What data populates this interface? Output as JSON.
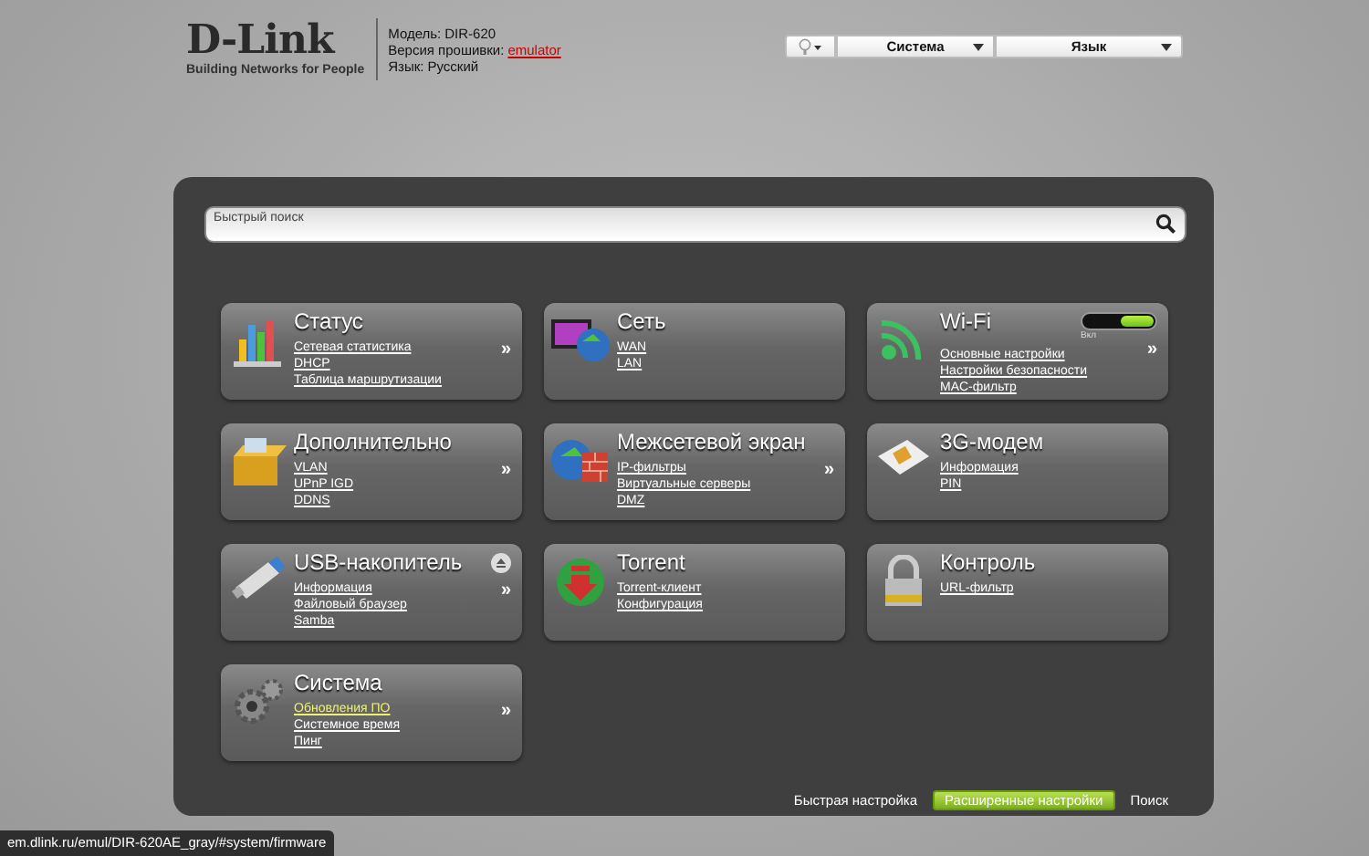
{
  "header": {
    "logo": "D-Link",
    "tagline": "Building Networks for People",
    "info": [
      {
        "label": "Модель:",
        "value": "DIR-620",
        "warn": false
      },
      {
        "label": "Версия прошивки:",
        "value": "emulator",
        "warn": true
      },
      {
        "label": "Язык:",
        "value": "Русский",
        "warn": false
      }
    ],
    "menus": [
      {
        "label": "Система"
      },
      {
        "label": "Язык"
      }
    ]
  },
  "search": {
    "placeholder": "Быстрый поиск"
  },
  "cards": [
    {
      "title": "Статус",
      "more": true,
      "eject": false,
      "links": [
        {
          "text": "Сетевая статистика",
          "highlighted": false
        },
        {
          "text": "DHCP",
          "highlighted": false
        },
        {
          "text": "Таблица маршрутизации",
          "highlighted": false
        }
      ]
    },
    {
      "title": "Сеть",
      "more": false,
      "eject": false,
      "links": [
        {
          "text": "WAN",
          "highlighted": false
        },
        {
          "text": "LAN",
          "highlighted": false
        }
      ]
    },
    {
      "title": "Wi-Fi",
      "more": true,
      "eject": false,
      "toggle": {
        "label": "Вкл",
        "on": true
      },
      "links": [
        {
          "text": "Основные настройки",
          "highlighted": false
        },
        {
          "text": "Настройки безопасности",
          "highlighted": false
        },
        {
          "text": "MAC-фильтр",
          "highlighted": false
        }
      ]
    },
    {
      "title": "Дополнительно",
      "more": true,
      "eject": false,
      "links": [
        {
          "text": "VLAN",
          "highlighted": false
        },
        {
          "text": "UPnP IGD",
          "highlighted": false
        },
        {
          "text": "DDNS",
          "highlighted": false
        }
      ]
    },
    {
      "title": "Межсетевой экран",
      "more": true,
      "eject": false,
      "links": [
        {
          "text": "IP-фильтры",
          "highlighted": false
        },
        {
          "text": "Виртуальные серверы",
          "highlighted": false
        },
        {
          "text": "DMZ",
          "highlighted": false
        }
      ]
    },
    {
      "title": "3G-модем",
      "more": false,
      "eject": false,
      "links": [
        {
          "text": "Информация",
          "highlighted": false
        },
        {
          "text": "PIN",
          "highlighted": false
        }
      ]
    },
    {
      "title": "USB-накопитель",
      "more": true,
      "eject": true,
      "links": [
        {
          "text": "Информация",
          "highlighted": false
        },
        {
          "text": "Файловый браузер",
          "highlighted": false
        },
        {
          "text": "Samba",
          "highlighted": false
        }
      ]
    },
    {
      "title": "Torrent",
      "more": false,
      "eject": false,
      "links": [
        {
          "text": "Torrent-клиент",
          "highlighted": false
        },
        {
          "text": "Конфигурация",
          "highlighted": false
        }
      ]
    },
    {
      "title": "Контроль",
      "more": false,
      "eject": false,
      "links": [
        {
          "text": "URL-фильтр",
          "highlighted": false
        }
      ]
    },
    {
      "title": "Система",
      "more": true,
      "eject": false,
      "links": [
        {
          "text": "Обновления ПО",
          "highlighted": true
        },
        {
          "text": "Системное время",
          "highlighted": false
        },
        {
          "text": "Пинг",
          "highlighted": false
        }
      ]
    }
  ],
  "more_glyph": "»",
  "footer": {
    "quick": "Быстрая настройка",
    "advanced": "Расширенные настройки",
    "search": "Поиск"
  },
  "status_bar": "em.dlink.ru/emul/DIR-620AE_gray/#system/firmware"
}
